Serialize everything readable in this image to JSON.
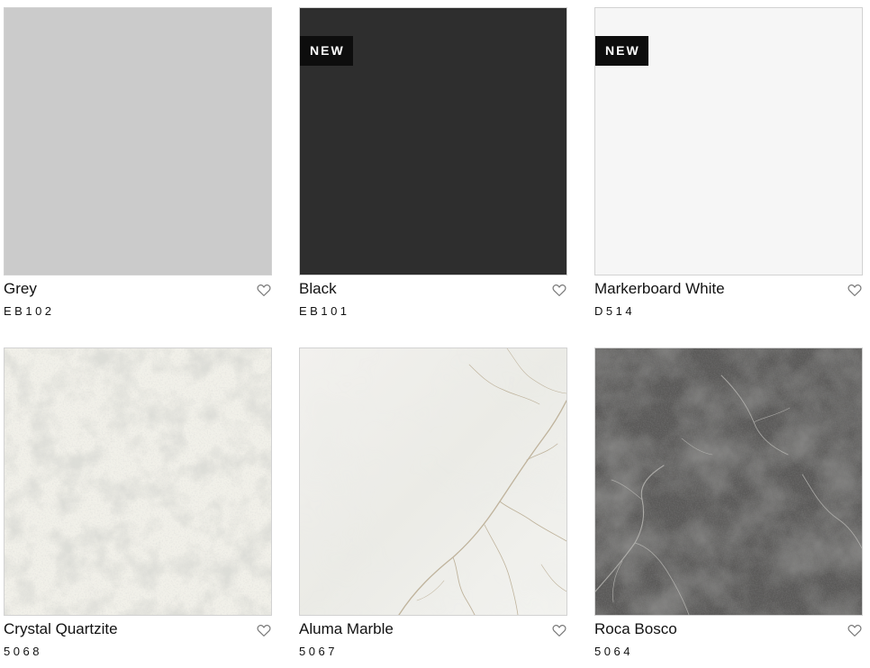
{
  "products": [
    {
      "name": "Grey",
      "code": "EB102",
      "badge": "",
      "swatch_color": "#cbcbcb",
      "texture": "solid"
    },
    {
      "name": "Black",
      "code": "EB101",
      "badge": "NEW",
      "swatch_color": "#2e2e2e",
      "texture": "solid"
    },
    {
      "name": "Markerboard White",
      "code": "D514",
      "badge": "NEW",
      "swatch_color": "#f6f6f6",
      "texture": "solid"
    },
    {
      "name": "Crystal Quartzite",
      "code": "5068",
      "badge": "",
      "swatch_color": "#f0efe8",
      "texture": "quartzite"
    },
    {
      "name": "Aluma Marble",
      "code": "5067",
      "badge": "",
      "swatch_color": "#eeeeea",
      "texture": "marble"
    },
    {
      "name": "Roca Bosco",
      "code": "5064",
      "badge": "",
      "swatch_color": "#585756",
      "texture": "dark-stone"
    }
  ],
  "icons": {
    "favorite": "heart-outline-icon"
  }
}
